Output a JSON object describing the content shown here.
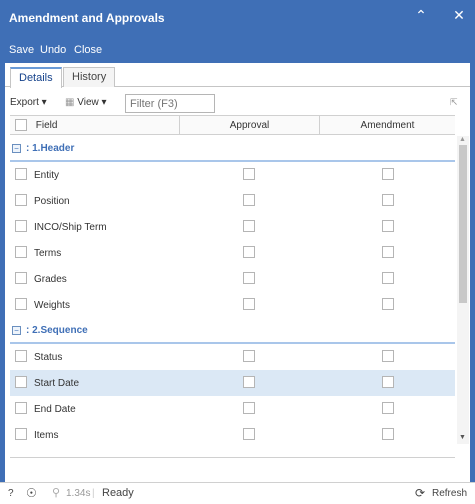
{
  "window": {
    "title": "Amendment and Approvals"
  },
  "toolbar": {
    "save": "Save",
    "undo": "Undo",
    "close": "Close"
  },
  "tabs": [
    {
      "label": "Details",
      "active": true
    },
    {
      "label": "History",
      "active": false
    }
  ],
  "gridbar": {
    "export": "Export",
    "view": "View",
    "filter_placeholder": "Filter (F3)"
  },
  "columns": {
    "field": "Field",
    "approval": "Approval",
    "amendment": "Amendment"
  },
  "groups": [
    {
      "label": ": 1.Header",
      "rows": [
        "Entity",
        "Position",
        "INCO/Ship Term",
        "Terms",
        "Grades",
        "Weights"
      ]
    },
    {
      "label": ": 2.Sequence",
      "rows": [
        "Status",
        "Start Date",
        "End Date",
        "Items"
      ]
    }
  ],
  "selected_row": "Start Date",
  "status": {
    "help": "?",
    "timing": "1.34s",
    "state": "Ready",
    "refresh": "Refresh"
  },
  "colors": {
    "accent": "#3f6fb6",
    "selection": "#dbe8f5"
  }
}
